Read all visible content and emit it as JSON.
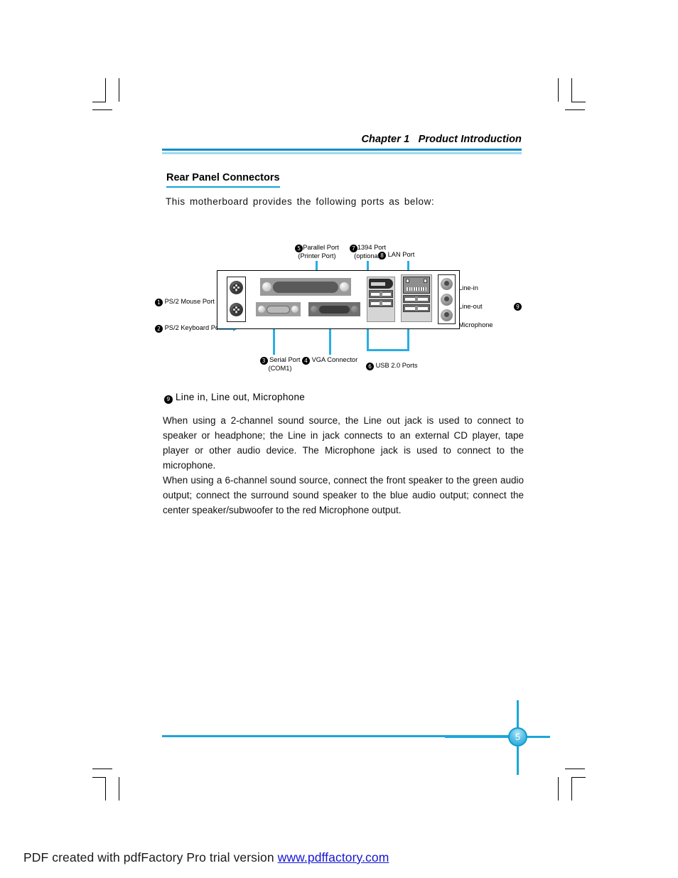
{
  "header": {
    "chapter_title": "Chapter 1   Product Introduction",
    "rule_color_dark": "#0a8ec9",
    "rule_color_light": "#9fd9ea"
  },
  "section": {
    "heading": "Rear Panel Connectors",
    "intro": "This motherboard provides the following ports as below:",
    "underline_color": "#12a3d4"
  },
  "diagram": {
    "accent_color": "#29ade4",
    "labels": {
      "ps2_mouse": {
        "num": "1",
        "text": "PS/2 Mouse Port"
      },
      "ps2_keyboard": {
        "num": "2",
        "text": "PS/2 Keyboard Port"
      },
      "serial": {
        "num": "3",
        "line1": "Serial Port",
        "line2": "(COM1)"
      },
      "vga": {
        "num": "4",
        "text": "VGA Connector"
      },
      "parallel": {
        "num": "5",
        "line1": "Parallel Port",
        "line2": "(Printer Port)"
      },
      "usb": {
        "num": "6",
        "text": "USB 2.0 Ports"
      },
      "ieee1394": {
        "num": "7",
        "line1": "1394 Port",
        "line2": "(optional)"
      },
      "lan": {
        "num": "8",
        "text": "LAN Port"
      },
      "audio_group_num": "9",
      "line_in": "Line-in",
      "line_out": "Line-out",
      "microphone": "Microphone"
    }
  },
  "audio_section": {
    "item_num": "9",
    "item_title": "Line in, Line out, Microphone",
    "paragraph_1": "When using a 2-channel sound source, the Line out jack is used to connect to speaker or headphone; the Line in jack connects to an external CD player, tape player or other audio device. The Microphone jack is used to connect to the microphone.",
    "paragraph_2": "When using a 6-channel sound source, connect the front speaker to the green audio output; connect the surround sound speaker to the blue audio output; connect the center speaker/subwoofer to the red Microphone output."
  },
  "footer": {
    "page_number": "5",
    "rule_color": "#1ba6d8",
    "pdf_note_text": "PDF created with pdfFactory Pro trial version ",
    "pdf_note_link": "www.pdffactory.com"
  }
}
